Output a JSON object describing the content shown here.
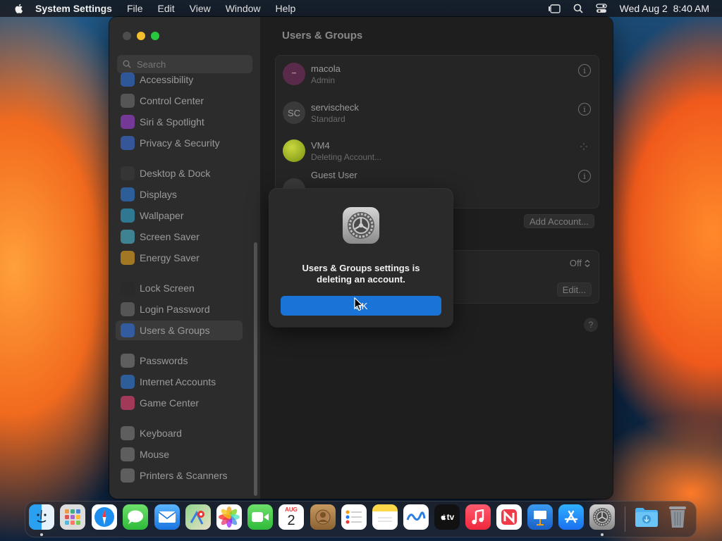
{
  "menubar": {
    "app_name": "System Settings",
    "menus": [
      "File",
      "Edit",
      "View",
      "Window",
      "Help"
    ],
    "clock": "Wed Aug 2  8:40 AM"
  },
  "sidebar": {
    "search_placeholder": "Search",
    "items": [
      {
        "label": "Accessibility",
        "icon": "accessibility-icon",
        "color": "#2f6fd6"
      },
      {
        "label": "Control Center",
        "icon": "control-center-icon",
        "color": "#6b6b6b"
      },
      {
        "label": "Siri & Spotlight",
        "icon": "siri-icon",
        "color": "#9b3fd0"
      },
      {
        "label": "Privacy & Security",
        "icon": "hand-icon",
        "color": "#3a6fd6"
      },
      {
        "label": "Desktop & Dock",
        "icon": "dock-icon",
        "color": "#3a3a3a"
      },
      {
        "label": "Displays",
        "icon": "sun-icon",
        "color": "#2f7ad6"
      },
      {
        "label": "Wallpaper",
        "icon": "wallpaper-icon",
        "color": "#33a0c8"
      },
      {
        "label": "Screen Saver",
        "icon": "screen-saver-icon",
        "color": "#4ab0c8"
      },
      {
        "label": "Energy Saver",
        "icon": "battery-icon",
        "color": "#e0a020"
      },
      {
        "label": "Lock Screen",
        "icon": "lock-icon",
        "color": "#2a2a2a"
      },
      {
        "label": "Login Password",
        "icon": "key-lock-icon",
        "color": "#6b6b6b"
      },
      {
        "label": "Users & Groups",
        "icon": "users-icon",
        "color": "#2f6fd6"
      },
      {
        "label": "Passwords",
        "icon": "key-icon",
        "color": "#7a7a7a"
      },
      {
        "label": "Internet Accounts",
        "icon": "at-icon",
        "color": "#2f7ad6"
      },
      {
        "label": "Game Center",
        "icon": "game-center-icon",
        "color": "#e04070"
      },
      {
        "label": "Keyboard",
        "icon": "keyboard-icon",
        "color": "#7a7a7a"
      },
      {
        "label": "Mouse",
        "icon": "mouse-icon",
        "color": "#7a7a7a"
      },
      {
        "label": "Printers & Scanners",
        "icon": "printer-icon",
        "color": "#7a7a7a"
      }
    ],
    "selected": "Users & Groups"
  },
  "content": {
    "title": "Users & Groups",
    "users": [
      {
        "name": "macola",
        "role": "Admin",
        "avatar_text": "",
        "avatar_color": "#5a2a4a"
      },
      {
        "name": "servischeck",
        "role": "Standard",
        "avatar_text": "SC",
        "avatar_color": "#3a3a3a"
      },
      {
        "name": "VM4",
        "role": "Deleting Account...",
        "avatar_text": "",
        "avatar_color": "#8aa020"
      },
      {
        "name": "Guest User",
        "role": "",
        "avatar_text": "",
        "avatar_color": "#3a3a3a"
      }
    ],
    "add_account_label": "Add Account...",
    "off_value": "Off",
    "edit_label": "Edit...",
    "help_label": "?"
  },
  "dialog": {
    "message": "Users & Groups settings is deleting an account.",
    "ok_label": "OK"
  },
  "dock": {
    "calendar_month": "AUG",
    "calendar_day": "2",
    "tv_label": "tv",
    "apps": [
      "Finder",
      "Launchpad",
      "Safari",
      "Messages",
      "Mail",
      "Maps",
      "Photos",
      "FaceTime",
      "Calendar",
      "Contacts",
      "Reminders",
      "Notes",
      "Freeform",
      "TV",
      "Music",
      "News",
      "Keynote",
      "App Store",
      "System Settings",
      "Downloads",
      "Trash"
    ]
  }
}
